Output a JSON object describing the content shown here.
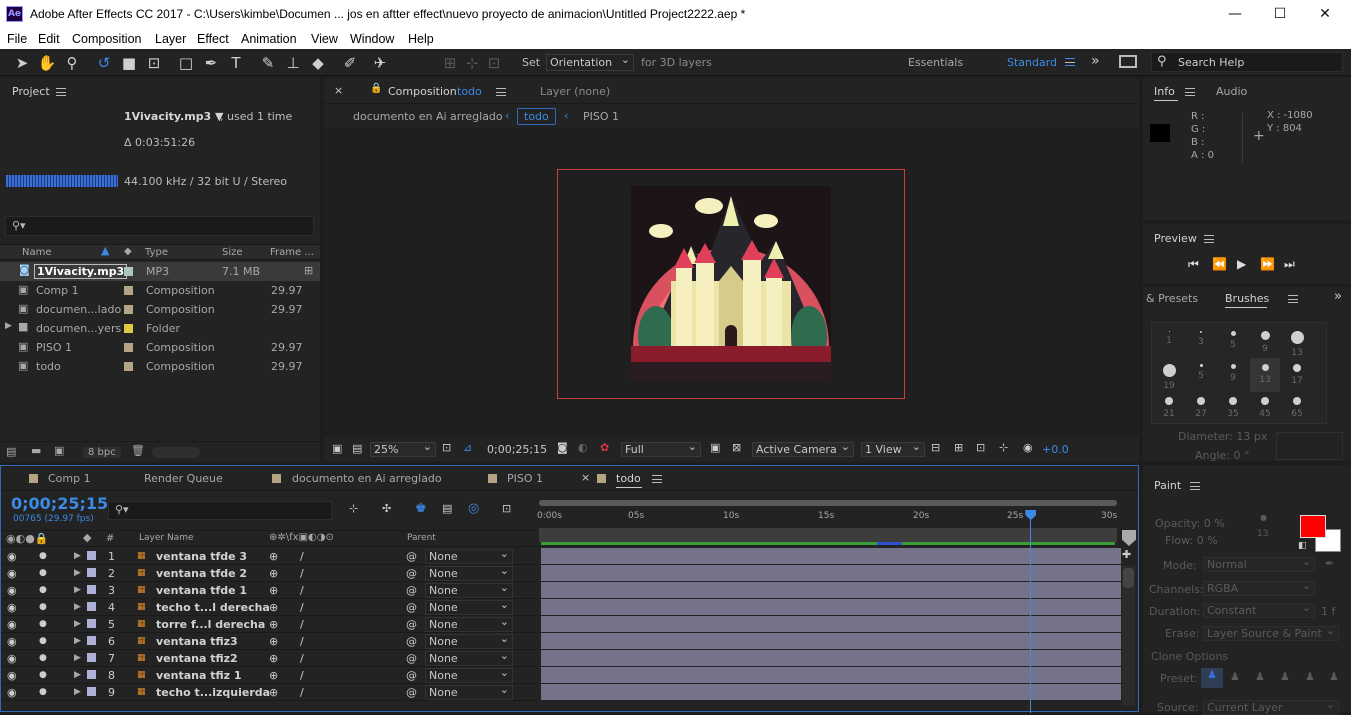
{
  "window": {
    "app_icon": "Ae",
    "title": "Adobe After Effects CC 2017 - C:\\Users\\kimbe\\Documen ... jos en aftter effect\\nuevo proyecto de animacion\\Untitled Project2222.aep *",
    "minimize": "—",
    "maximize": "☐",
    "close": "✕"
  },
  "menu": [
    "File",
    "Edit",
    "Composition",
    "Layer",
    "Effect",
    "Animation",
    "View",
    "Window",
    "Help"
  ],
  "toolbar": {
    "set_label": "Set",
    "orientation_value": "Orientation",
    "for3d_label": "for 3D layers",
    "workspaces": [
      "Essentials",
      "Standard"
    ],
    "more": "»",
    "search_placeholder": "Search Help"
  },
  "project": {
    "title": "Project",
    "item_name": "1Vivacity.mp3 ▼",
    "used": ", used 1 time",
    "duration": "Δ 0:03:51:26",
    "audio_info": "44.100 kHz / 32 bit U / Stereo",
    "search_placeholder": "",
    "columns": [
      "Name",
      "Type",
      "Size",
      "Frame ..."
    ],
    "items": [
      {
        "name": "1Vivacity.mp3",
        "type": "MP3",
        "size": "7.1 MB",
        "frame": "",
        "color": "#aec4c2",
        "icon": "audio-icon"
      },
      {
        "name": "Comp 1",
        "type": "Composition",
        "size": "",
        "frame": "29.97",
        "color": "#b5a483",
        "icon": "composition-icon"
      },
      {
        "name": "documen...lado",
        "type": "Composition",
        "size": "",
        "frame": "29.97",
        "color": "#b5a483",
        "icon": "composition-icon"
      },
      {
        "name": "documen...yers",
        "type": "Folder",
        "size": "",
        "frame": "",
        "color": "#e0c840",
        "icon": "folder-icon"
      },
      {
        "name": "PISO 1",
        "type": "Composition",
        "size": "",
        "frame": "29.97",
        "color": "#b5a483",
        "icon": "composition-icon"
      },
      {
        "name": "todo",
        "type": "Composition",
        "size": "",
        "frame": "29.97",
        "color": "#b5a483",
        "icon": "composition-icon"
      }
    ],
    "bpc": "8 bpc"
  },
  "composition": {
    "tab_prefix": "Composition",
    "tab_name": "todo",
    "layer_tab": "Layer (none)",
    "breadcrumbs": [
      "documento en Ai arreglado",
      "todo",
      "PISO 1"
    ],
    "zoom": "25%",
    "timecode": "0;00;25;15",
    "resolution": "Full",
    "camera": "Active Camera",
    "view": "1 View",
    "exposure": "+0.0"
  },
  "info": {
    "tab_info": "Info",
    "tab_audio": "Audio",
    "r": "R :",
    "g": "G :",
    "b": "B :",
    "a": "A : 0",
    "x": "X : -1080",
    "y": "Y : 804"
  },
  "preview": {
    "title": "Preview"
  },
  "brushes": {
    "presets_tab": "& Presets",
    "brushes_tab": "Brushes",
    "sizes": [
      "1",
      "3",
      "5",
      "9",
      "13",
      "19",
      "5",
      "9",
      "13",
      "17",
      "21",
      "27",
      "35",
      "45",
      "65"
    ],
    "diameter": "Diameter: 13 px",
    "angle": "Angle: 0 °"
  },
  "paint": {
    "title": "Paint",
    "opacity": "Opacity:  0 %",
    "flow": "Flow:  0 %",
    "brush_size": "13",
    "mode_label": "Mode:",
    "mode_value": "Normal",
    "channels_label": "Channels:",
    "channels_value": "RGBA",
    "duration_label": "Duration:",
    "duration_value": "Constant",
    "duration_frames": "1  f",
    "erase_label": "Erase:",
    "erase_value": "Layer Source & Paint",
    "clone_options": "Clone Options",
    "preset_label": "Preset:",
    "source_label": "Source:",
    "source_value": "Current Layer",
    "fg_color": "#ff0000",
    "bg_color": "#ffffff"
  },
  "timeline": {
    "tabs": [
      "Comp 1",
      "Render Queue",
      "documento en Ai arreglado",
      "PISO 1",
      "todo"
    ],
    "timecode": "0;00;25;15",
    "frame_info": "00765 (29.97 fps)",
    "ruler": [
      "0:00s",
      "05s",
      "10s",
      "15s",
      "20s",
      "25s",
      "30s"
    ],
    "col_layer_name": "Layer Name",
    "col_parent": "Parent",
    "col_num": "#",
    "layers": [
      {
        "num": "1",
        "name": "ventana tfde 3",
        "parent": "None"
      },
      {
        "num": "2",
        "name": "ventana tfde 2",
        "parent": "None"
      },
      {
        "num": "3",
        "name": "ventana tfde 1",
        "parent": "None"
      },
      {
        "num": "4",
        "name": "techo t...l derecha",
        "parent": "None"
      },
      {
        "num": "5",
        "name": "torre f...l derecha",
        "parent": "None"
      },
      {
        "num": "6",
        "name": "ventana tfiz3",
        "parent": "None"
      },
      {
        "num": "7",
        "name": "ventana tfiz2",
        "parent": "None"
      },
      {
        "num": "8",
        "name": "ventana tfiz 1",
        "parent": "None"
      },
      {
        "num": "9",
        "name": "techo t...izquierda",
        "parent": "None"
      }
    ],
    "playhead_fraction": 0.85
  }
}
